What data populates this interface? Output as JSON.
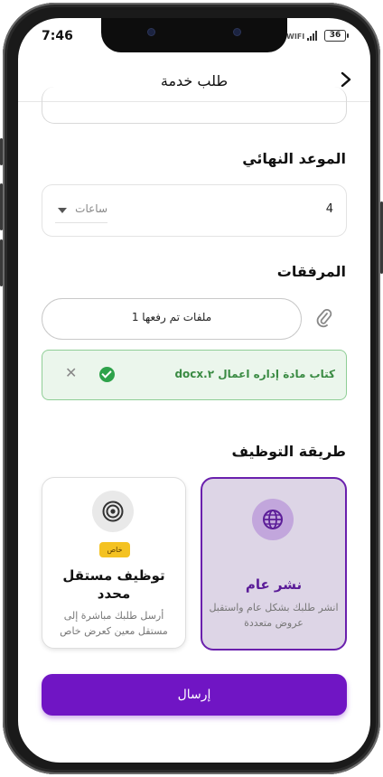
{
  "status": {
    "time": "7:46",
    "wifi_label": "WIFI",
    "battery": "36"
  },
  "header": {
    "title": "طلب خدمة",
    "back_icon": "chevron-right-icon"
  },
  "deadline": {
    "title": "الموعد النهائي",
    "value": "4",
    "unit": "ساعات"
  },
  "attachments": {
    "title": "المرفقات",
    "uploaded_label": "1 ملفات تم رفعها",
    "file_name": "كتاب مادة إداره اعمال ٢.docx"
  },
  "hiring": {
    "title": "طريقة التوظيف",
    "options": [
      {
        "title": "نشر عام",
        "desc": "انشر طلبك بشكل عام واستقبل عروض متعددة",
        "icon": "globe-icon",
        "selected": true
      },
      {
        "title": "توظيف مستقل محدد",
        "badge": "خاص",
        "desc": "أرسل طلبك مباشرة إلى مستقل معين كعرض خاص",
        "icon": "target-icon",
        "selected": false
      }
    ]
  },
  "submit_label": "إرسال",
  "colors": {
    "primary": "#7015c4",
    "success": "#2ea24a",
    "badge": "#f4c222",
    "selected_card": "#ddd5e6"
  }
}
